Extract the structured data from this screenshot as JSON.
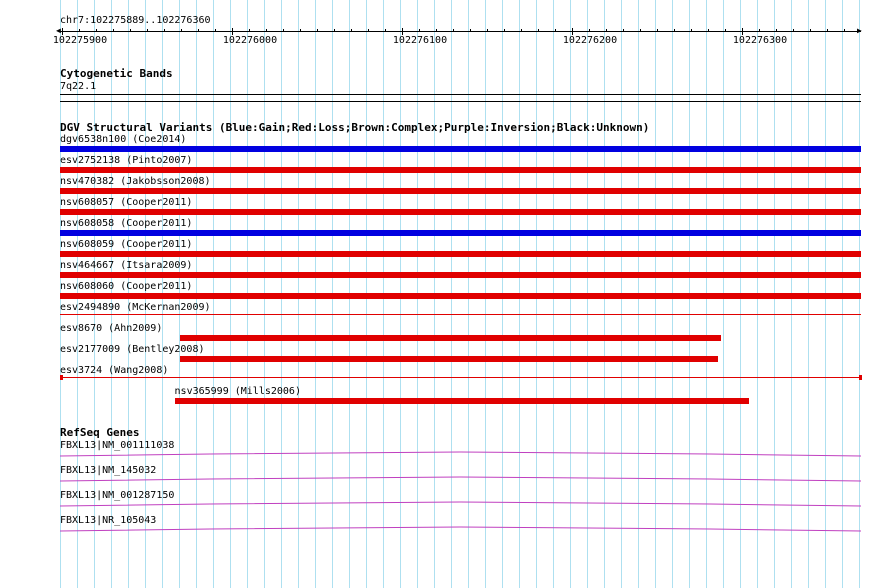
{
  "ruler": {
    "region": "chr7:102275889..102276360",
    "ticks": [
      "102275900",
      "102276000",
      "102276100",
      "102276200",
      "102276300"
    ]
  },
  "cytoband": {
    "title": "Cytogenetic Bands",
    "band": "7q22.1"
  },
  "dgv": {
    "title": "DGV Structural Variants (Blue:Gain;Red:Loss;Brown:Complex;Purple:Inversion;Black:Unknown)",
    "variants": [
      {
        "label": "dgv6538n100 (Coe2014)",
        "type": "gain",
        "start": 0,
        "end": 1
      },
      {
        "label": "esv2752138 (Pinto2007)",
        "type": "loss",
        "start": 0,
        "end": 1
      },
      {
        "label": "nsv470382 (Jakobsson2008)",
        "type": "loss",
        "start": 0,
        "end": 1
      },
      {
        "label": "nsv608057 (Cooper2011)",
        "type": "loss",
        "start": 0,
        "end": 1
      },
      {
        "label": "nsv608058 (Cooper2011)",
        "type": "gain",
        "start": 0,
        "end": 1
      },
      {
        "label": "nsv608059 (Cooper2011)",
        "type": "loss",
        "start": 0,
        "end": 1
      },
      {
        "label": "nsv464667 (Itsara2009)",
        "type": "loss",
        "start": 0,
        "end": 1
      },
      {
        "label": "nsv608060 (Cooper2011)",
        "type": "loss",
        "start": 0,
        "end": 1
      },
      {
        "label": "esv2494890 (McKernan2009)",
        "type": "loss-thin",
        "start": 0,
        "end": 1
      },
      {
        "label": "esv8670 (Ahn2009)",
        "type": "loss",
        "start": 0.15,
        "end": 0.825
      },
      {
        "label": "esv2177009 (Bentley2008)",
        "type": "loss",
        "start": 0.15,
        "end": 0.822
      },
      {
        "label": "esv3724 (Wang2008)",
        "type": "loss-thin",
        "start": 0,
        "end": 1
      },
      {
        "label": "nsv365999 (Mills2006)",
        "type": "loss",
        "start": 0.143,
        "end": 0.86
      }
    ]
  },
  "refseq": {
    "title": "RefSeq Genes",
    "genes": [
      {
        "label": "FBXL13|NM_001111038"
      },
      {
        "label": "FBXL13|NM_145032"
      },
      {
        "label": "FBXL13|NM_001287150"
      },
      {
        "label": "FBXL13|NR_105043"
      }
    ]
  },
  "colors": {
    "gain": "#0000e0",
    "loss": "#e00000",
    "gene": "#c040c0",
    "grid": "#aee0f0"
  }
}
